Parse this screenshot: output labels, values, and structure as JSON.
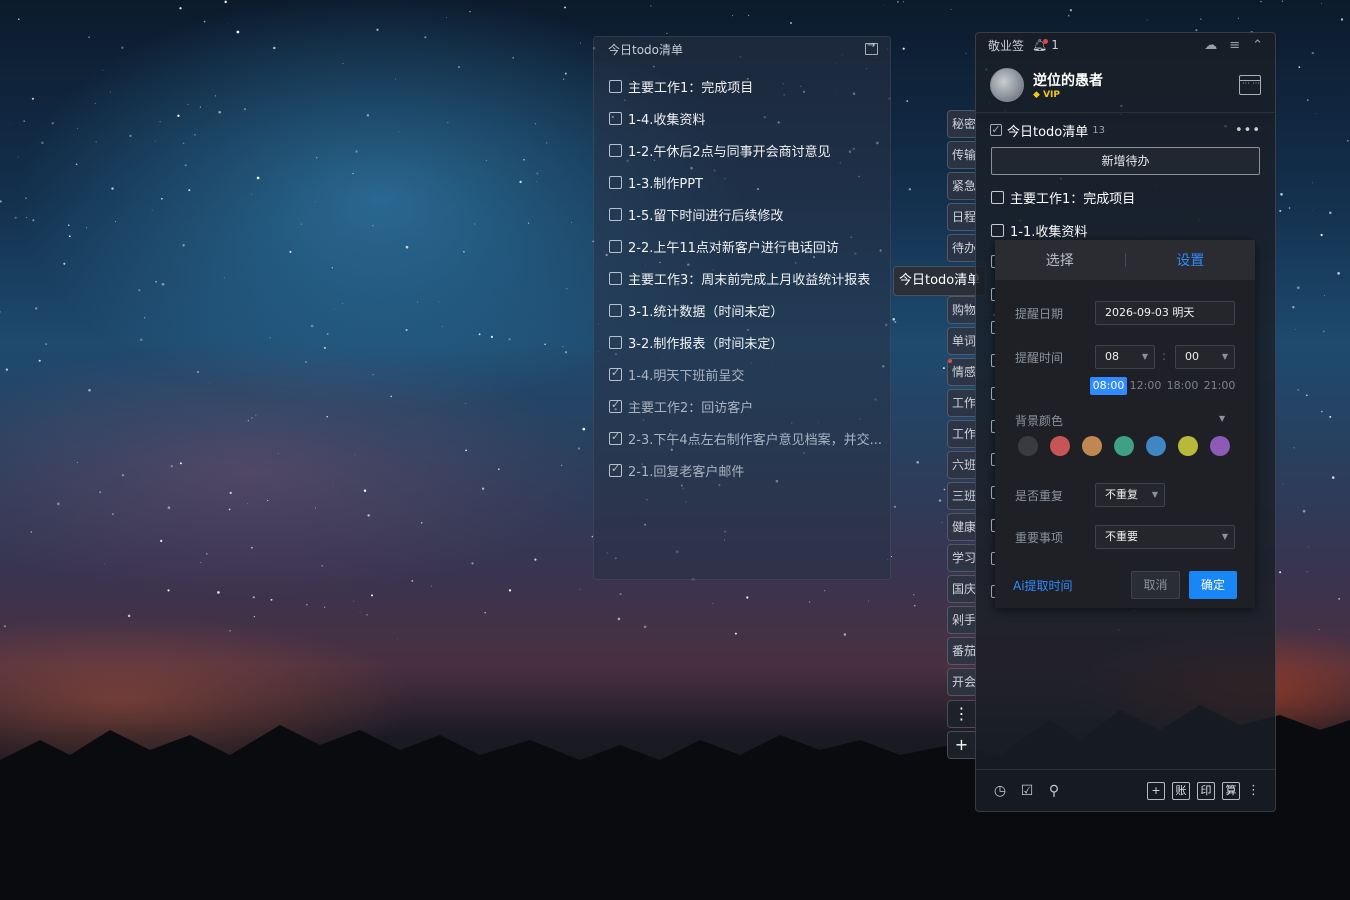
{
  "todo_panel": {
    "title": "今日todo清单",
    "items": [
      {
        "text": "主要工作1：完成项目",
        "done": false
      },
      {
        "text": "1-4.收集资料",
        "done": false
      },
      {
        "text": "1-2.午休后2点与同事开会商讨意见",
        "done": false
      },
      {
        "text": "1-3.制作PPT",
        "done": false
      },
      {
        "text": "1-5.留下时间进行后续修改",
        "done": false
      },
      {
        "text": "2-2.上午11点对新客户进行电话回访",
        "done": false
      },
      {
        "text": "主要工作3：周末前完成上月收益统计报表",
        "done": false
      },
      {
        "text": "3-1.统计数据（时间未定）",
        "done": false
      },
      {
        "text": "3-2.制作报表（时间未定）",
        "done": false
      },
      {
        "text": "1-4.明天下班前呈交",
        "done": true
      },
      {
        "text": "主要工作2：回访客户",
        "done": true
      },
      {
        "text": "2-3.下午4点左右制作客户意见档案，并交...",
        "done": true
      },
      {
        "text": "2-1.回复老客户邮件",
        "done": true
      }
    ]
  },
  "tags": [
    "秘密",
    "传输",
    "紧急",
    "日程",
    "待办",
    "今日todo清单",
    "购物",
    "单词",
    "情感",
    "工作",
    "工作",
    "六班",
    "三班",
    "健康",
    "学习",
    "国庆",
    "剁手",
    "番茄",
    "开会"
  ],
  "tooltip": "今日todo清单",
  "side_buttons": {
    "more": "⋮",
    "add": "+"
  },
  "app": {
    "name": "敬业签",
    "notification_count": "1",
    "user": {
      "name": "逆位的愚者",
      "badge": "VIP"
    },
    "list": {
      "title": "今日todo清单",
      "count": "13",
      "more": "•••"
    },
    "new_button": "新增待办",
    "items": [
      "主要工作1：完成项目",
      "1-1.收集资料"
    ],
    "footer": {
      "buttons": [
        "+",
        "账",
        "印",
        "算"
      ]
    }
  },
  "popup": {
    "tabs": [
      "选择",
      "设置"
    ],
    "date_label": "提醒日期",
    "date_value": "2026-09-03 明天",
    "time_label": "提醒时间",
    "hour": "08",
    "minute": "00",
    "time_sep": ":",
    "quick_times": [
      "08:00",
      "12:00",
      "18:00",
      "21:00"
    ],
    "color_label": "背景颜色",
    "colors": [
      "#3a3b3f",
      "#c65555",
      "#c08850",
      "#3fa086",
      "#3f86c4",
      "#b8b83a",
      "#8e5ab8"
    ],
    "repeat_label": "是否重复",
    "repeat_value": "不重复",
    "importance_label": "重要事项",
    "importance_value": "不重要",
    "ai_link": "Ai提取时间",
    "cancel": "取消",
    "ok": "确定"
  }
}
